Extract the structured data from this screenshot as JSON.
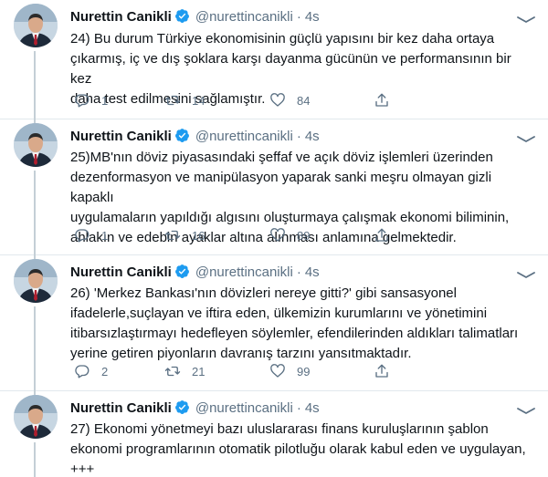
{
  "tweets": [
    {
      "name": "Nurettin Canikli",
      "handle": "@nurettincanikli",
      "dot": "·",
      "time": "4s",
      "text": "24) Bu durum Türkiye ekonomisinin güçlü yapısını bir kez daha ortaya\nçıkarmış, iç ve dış şoklara karşı dayanma gücünün ve performansının bir kez\ndaha test edilmesini sağlamıştır.",
      "replies": "1",
      "retweets": "14",
      "likes": "84"
    },
    {
      "name": "Nurettin Canikli",
      "handle": "@nurettincanikli",
      "dot": "·",
      "time": "4s",
      "text": "25)MB'nın döviz piyasasındaki şeffaf ve açık döviz işlemleri üzerinden\ndezenformasyon ve manipülasyon yaparak sanki meşru olmayan gizli kapaklı\nuygulamaların yapıldığı algısını oluşturmaya çalışmak ekonomi biliminin,\nahlakın ve edebin ayaklar altına alınması anlamına gelmektedir.",
      "replies": "1",
      "retweets": "16",
      "likes": "89"
    },
    {
      "name": "Nurettin Canikli",
      "handle": "@nurettincanikli",
      "dot": "·",
      "time": "4s",
      "text": "26) 'Merkez Bankası'nın dövizleri nereye gitti?' gibi sansasyonel\nifadelerle,suçlayan ve iftira eden, ülkemizin kurumlarını ve yönetimini\nitibarsızlaştırmayı hedefleyen söylemler, efendilerinden aldıkları talimatları\nyerine getiren piyonların davranış tarzını yansıtmaktadır.",
      "replies": "2",
      "retweets": "21",
      "likes": "99"
    },
    {
      "name": "Nurettin Canikli",
      "handle": "@nurettincanikli",
      "dot": "·",
      "time": "4s",
      "text": "27) Ekonomi yönetmeyi bazı uluslararası finans kuruluşlarının şablon\nekonomi programlarının otomatik pilotluğu olarak kabul eden ve uygulayan,\n+++"
    }
  ],
  "colors": {
    "text": "#0f1419",
    "muted": "#5b7083",
    "verified": "#1d9bf0",
    "thread_line": "#c4cfd6"
  },
  "icons": [
    "verified-badge-icon",
    "more-icon",
    "reply-icon",
    "retweet-icon",
    "like-icon",
    "share-icon"
  ]
}
